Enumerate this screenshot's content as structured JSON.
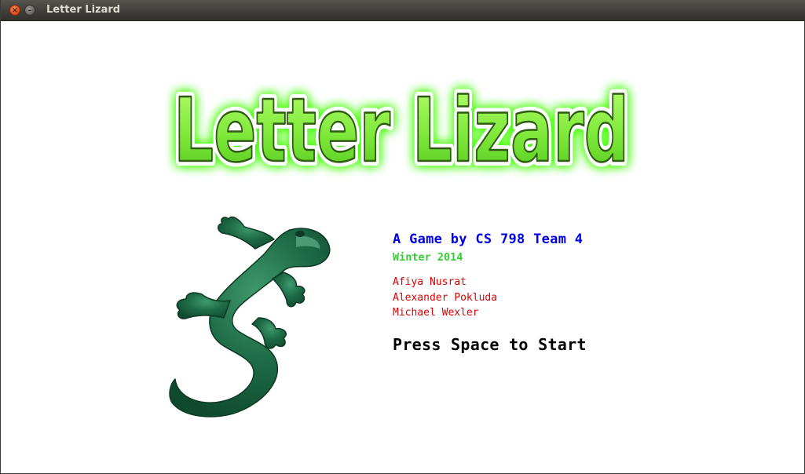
{
  "window": {
    "title": "Letter Lizard"
  },
  "game": {
    "title": "Letter Lizard",
    "credit": "A Game by CS 798 Team 4",
    "season": "Winter 2014",
    "team_members": [
      "Afiya Nusrat",
      "Alexander Pokluda",
      "Michael Wexler"
    ],
    "start_prompt": "Press Space to Start"
  },
  "colors": {
    "title_fill": "#7ee83a",
    "title_outline": "#2e5a12",
    "title_glow": "#44ff00",
    "lizard": "#1e6b47",
    "credit": "#0000e6",
    "season": "#33cc33",
    "members": "#e00000",
    "prompt": "#000000"
  }
}
